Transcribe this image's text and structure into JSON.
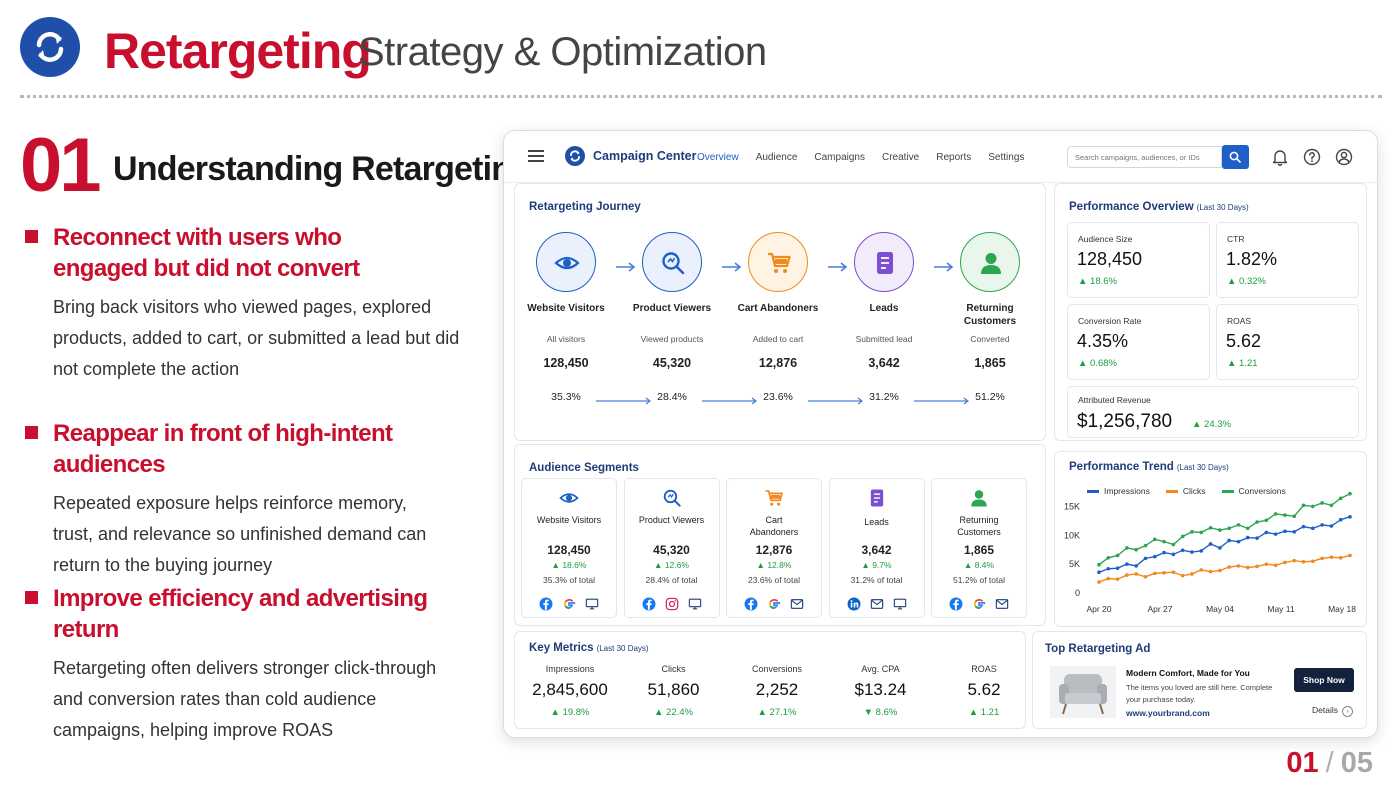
{
  "slide": {
    "title": "Retargeting",
    "subtitle": "Strategy & Optimization",
    "section_number": "01",
    "section_title": "Understanding Retargeting",
    "bullets": [
      {
        "heading": "Reconnect with users who engaged but did not convert",
        "body": "Bring back visitors who viewed pages, explored products, added to cart, or submitted a lead but did not complete the action"
      },
      {
        "heading": "Reappear in front of high-intent audiences",
        "body": "Repeated exposure helps reinforce memory, trust, and relevance so unfinished demand can return to the buying journey"
      },
      {
        "heading": "Improve efficiency and advertising return",
        "body": "Retargeting often delivers stronger click-through and conversion rates than cold audience campaigns, helping improve ROAS"
      }
    ],
    "page_current": "01",
    "page_separator": "/",
    "page_total": "05",
    "accent_color": "#c8102e"
  },
  "dashboard": {
    "app_name": "Campaign Center",
    "nav": [
      "Overview",
      "Audience",
      "Campaigns",
      "Creative",
      "Reports",
      "Settings"
    ],
    "search_placeholder": "Search campaigns, audiences, or IDs",
    "journey": {
      "title": "Retargeting Journey",
      "stages": [
        {
          "label": "Website Visitors",
          "sub": "All visitors",
          "value": "128,450",
          "pct": "35.3%",
          "icon": "eye-icon",
          "color": "#1f5fc8"
        },
        {
          "label": "Product Viewers",
          "sub": "Viewed products",
          "value": "45,320",
          "pct": "28.4%",
          "icon": "magnifier-icon",
          "color": "#1f5fc8"
        },
        {
          "label": "Cart Abandoners",
          "sub": "Added to cart",
          "value": "12,876",
          "pct": "23.6%",
          "icon": "cart-icon",
          "color": "#f08a1c"
        },
        {
          "label": "Leads",
          "sub": "Submitted lead",
          "value": "3,642",
          "pct": "31.2%",
          "icon": "form-icon",
          "color": "#7b4fd1"
        },
        {
          "label": "Returning Customers",
          "sub": "Converted",
          "value": "1,865",
          "pct": "51.2%",
          "icon": "user-icon",
          "color": "#2ea54f"
        }
      ]
    },
    "performance": {
      "title": "Performance Overview",
      "period": "(Last 30 Days)",
      "kpis": [
        {
          "label": "Audience Size",
          "value": "128,450",
          "delta": "▲ 18.6%"
        },
        {
          "label": "CTR",
          "value": "1.82%",
          "delta": "▲ 0.32%"
        },
        {
          "label": "Conversion Rate",
          "value": "4.35%",
          "delta": "▲ 0.68%"
        },
        {
          "label": "ROAS",
          "value": "5.62",
          "delta": "▲ 1.21"
        },
        {
          "label": "Attributed Revenue",
          "value": "$1,256,780",
          "delta": "▲ 24.3%"
        }
      ]
    },
    "segments": {
      "title": "Audience Segments",
      "items": [
        {
          "label": "Website Visitors",
          "value": "128,450",
          "delta": "▲ 18.6%",
          "share": "35.3% of total",
          "channels": [
            "facebook-icon",
            "google-icon",
            "display-icon"
          ]
        },
        {
          "label": "Product Viewers",
          "value": "45,320",
          "delta": "▲ 12.6%",
          "share": "28.4% of total",
          "channels": [
            "facebook-icon",
            "instagram-icon",
            "display-icon"
          ]
        },
        {
          "label": "Cart Abandoners",
          "value": "12,876",
          "delta": "▲ 12.8%",
          "share": "23.6% of total",
          "channels": [
            "facebook-icon",
            "google-icon",
            "email-icon"
          ]
        },
        {
          "label": "Leads",
          "value": "3,642",
          "delta": "▲ 9.7%",
          "share": "31.2% of total",
          "channels": [
            "linkedin-icon",
            "email-icon",
            "display-icon"
          ]
        },
        {
          "label": "Returning Customers",
          "value": "1,865",
          "delta": "▲ 8.4%",
          "share": "51.2% of total",
          "channels": [
            "facebook-icon",
            "google-icon",
            "email-icon"
          ]
        }
      ]
    },
    "key_metrics": {
      "title": "Key Metrics",
      "period": "(Last 30 Days)",
      "items": [
        {
          "label": "Impressions",
          "value": "2,845,600",
          "delta": "▲ 19.8%"
        },
        {
          "label": "Clicks",
          "value": "51,860",
          "delta": "▲ 22.4%"
        },
        {
          "label": "Conversions",
          "value": "2,252",
          "delta": "▲ 27.1%"
        },
        {
          "label": "Avg. CPA",
          "value": "$13.24",
          "delta": "▼ 8.6%"
        },
        {
          "label": "ROAS",
          "value": "5.62",
          "delta": "▲ 1.21"
        }
      ]
    },
    "top_ad": {
      "title": "Top Retargeting Ad",
      "headline": "Modern Comfort, Made for You",
      "body": "The items you loved are still here. Complete your purchase today.",
      "url": "www.yourbrand.com",
      "cta": "Shop Now",
      "details": "Details"
    }
  },
  "chart_data": {
    "type": "line",
    "title": "Performance Trend",
    "subtitle": "(Last 30 Days)",
    "x_tick_labels": [
      "Apr 20",
      "Apr 27",
      "May 04",
      "May 11",
      "May 18"
    ],
    "y_tick_labels": [
      "0",
      "5K",
      "10K",
      "15K"
    ],
    "ylim": [
      0,
      17500
    ],
    "legend_position": "top",
    "series": [
      {
        "name": "Impressions",
        "color": "#1f5fc8",
        "values": [
          3600,
          4200,
          4300,
          5000,
          4700,
          6000,
          6300,
          7000,
          6700,
          7400,
          7100,
          7300,
          8500,
          7800,
          9100,
          8900,
          9600,
          9500,
          10500,
          10200,
          10700,
          10600,
          11500,
          11200,
          11800,
          11600,
          12700,
          13200
        ]
      },
      {
        "name": "Clicks",
        "color": "#f08a1c",
        "values": [
          1900,
          2500,
          2400,
          3100,
          3300,
          2800,
          3400,
          3500,
          3600,
          3000,
          3300,
          4000,
          3700,
          3900,
          4500,
          4700,
          4400,
          4600,
          5000,
          4800,
          5300,
          5600,
          5400,
          5500,
          6000,
          6200,
          6100,
          6500
        ]
      },
      {
        "name": "Conversions",
        "color": "#2ea54f",
        "values": [
          4900,
          6100,
          6500,
          7800,
          7500,
          8200,
          9300,
          8900,
          8400,
          9800,
          10600,
          10500,
          11300,
          10900,
          11200,
          11800,
          11200,
          12300,
          12600,
          13700,
          13500,
          13300,
          15200,
          15000,
          15600,
          15200,
          16400,
          17200
        ]
      }
    ]
  }
}
